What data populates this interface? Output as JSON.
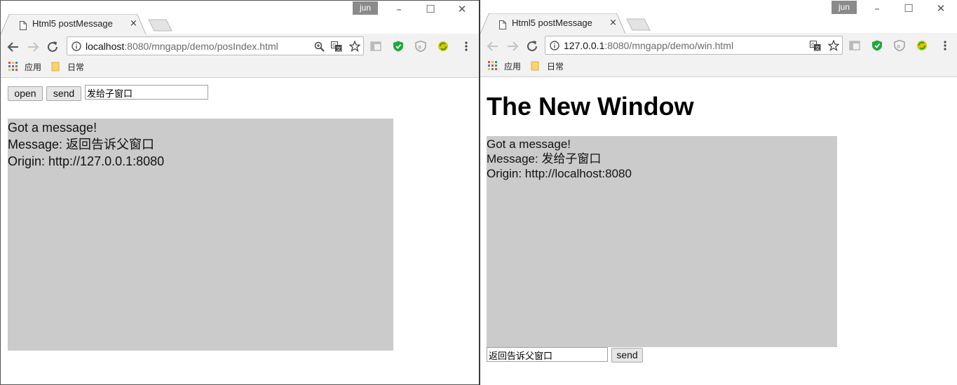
{
  "left": {
    "user_badge": "jun",
    "tab_title": "Html5 postMessage",
    "tab_close": "×",
    "url_host": "localhost",
    "url_rest": ":8080/mngapp/demo/posIndex.html",
    "bookmarks": [
      "应用",
      "日常"
    ],
    "open_button": "open",
    "send_button": "send",
    "message_input_value": "发给子窗口",
    "messages": [
      "Got a message!",
      "Message: 返回告诉父窗口",
      "Origin: http://127.0.0.1:8080"
    ]
  },
  "right": {
    "user_badge": "jun",
    "tab_title": "Html5 postMessage",
    "tab_close": "×",
    "url_host": "127.0.0.1",
    "url_rest": ":8080/mngapp/demo/win.html",
    "bookmarks": [
      "应用",
      "日常"
    ],
    "heading": "The New Window",
    "messages": [
      "Got a message!",
      "Message: 发给子窗口",
      "Origin: http://localhost:8080"
    ],
    "message_input_value": "返回告诉父窗口",
    "send_button": "send"
  },
  "window_controls": {
    "minimize": "–",
    "maximize": "☐",
    "close": "✕"
  },
  "colors": {
    "message_box": "#cbcbcb",
    "shield_green": "#1fa83b",
    "user_badge": "#8a8a8a"
  }
}
